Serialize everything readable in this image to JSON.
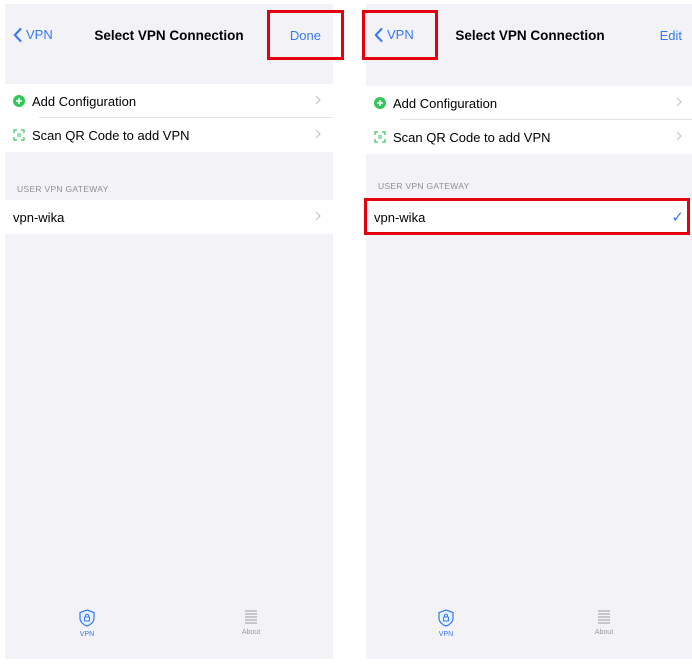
{
  "colors": {
    "accent": "#3478f6",
    "highlight": "#e4000f",
    "add_icon": "#34c759",
    "qr_icon": "#34c759",
    "disabled": "#9a9a9f",
    "background": "#f2f2f7"
  },
  "left": {
    "nav": {
      "back_label": "VPN",
      "title": "Select VPN Connection",
      "right_action": "Done"
    },
    "menu": {
      "add_configuration": "Add Configuration",
      "scan_qr": "Scan QR Code to add VPN"
    },
    "section_header": "USER VPN GATEWAY",
    "connections": [
      {
        "name": "vpn-wika",
        "selected": false
      }
    ],
    "tabs": [
      {
        "label": "VPN",
        "icon": "vpn-shield-icon",
        "active": true
      },
      {
        "label": "About",
        "icon": "list-icon",
        "active": false
      }
    ]
  },
  "right": {
    "nav": {
      "back_label": "VPN",
      "title": "Select VPN Connection",
      "right_action": "Edit"
    },
    "menu": {
      "add_configuration": "Add Configuration",
      "scan_qr": "Scan QR Code to add VPN"
    },
    "section_header": "USER VPN GATEWAY",
    "connections": [
      {
        "name": "vpn-wika",
        "selected": true,
        "check": "✓"
      }
    ],
    "tabs": [
      {
        "label": "VPN",
        "icon": "vpn-shield-icon",
        "active": true
      },
      {
        "label": "About",
        "icon": "list-icon",
        "active": false
      }
    ]
  }
}
